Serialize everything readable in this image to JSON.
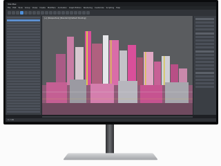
{
  "app": {
    "title": "3ds Max",
    "menu": [
      "File",
      "Edit",
      "Tools",
      "Group",
      "Views",
      "Create",
      "Modifiers",
      "Animation",
      "Graph Editors",
      "Rendering",
      "Customize",
      "Scripting",
      "Help"
    ]
  },
  "viewport": {
    "label": "[+] [Perspective] [Standard] [Default Shading]"
  },
  "statusbar": {
    "text": "0 / 100"
  },
  "colors": {
    "bezel": "#0a0b0d",
    "viewport_bg": "#5a5c5f",
    "panel_bg": "#3a3e44",
    "accent": "#4f8fd8",
    "wire_pink": "#d94f9a",
    "wire_yellow": "#d9c54f",
    "wire_white": "#e6e6ea"
  },
  "icons": [
    "toolbar-icon",
    "monitor-stand-icon"
  ]
}
